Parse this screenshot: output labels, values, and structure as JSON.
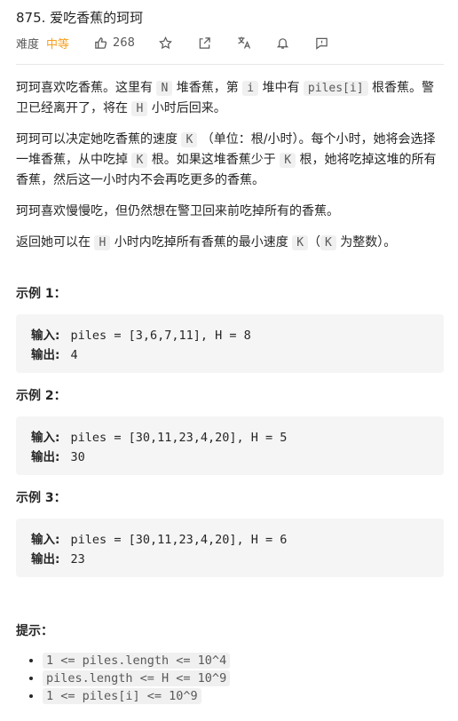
{
  "problem": {
    "number_title": "875. 爱吃香蕉的珂珂"
  },
  "meta": {
    "difficulty_label": "难度",
    "difficulty": "中等",
    "likes": "268",
    "difficulty_color": "#f7a01e"
  },
  "description": {
    "p1_a": "珂珂喜欢吃香蕉。这里有 ",
    "p1_N": "N",
    "p1_b": " 堆香蕉，第 ",
    "p1_i": "i",
    "p1_c": " 堆中有 ",
    "p1_piles": "piles[i]",
    "p1_d": " 根香蕉。警卫已经离开了，将在 ",
    "p1_H": "H",
    "p1_e": " 小时后回来。",
    "p2_a": "珂珂可以决定她吃香蕉的速度 ",
    "p2_K1": "K",
    "p2_b": " （单位：根/小时）。每个小时，她将会选择一堆香蕉，从中吃掉 ",
    "p2_K2": "K",
    "p2_c": " 根。如果这堆香蕉少于 ",
    "p2_K3": "K",
    "p2_d": " 根，她将吃掉这堆的所有香蕉，然后这一小时内不会再吃更多的香蕉。",
    "p3": "珂珂喜欢慢慢吃，但仍然想在警卫回来前吃掉所有的香蕉。",
    "p4_a": "返回她可以在 ",
    "p4_H": "H",
    "p4_b": " 小时内吃掉所有香蕉的最小速度 ",
    "p4_K1": "K",
    "p4_c": "（",
    "p4_K2": "K",
    "p4_d": " 为整数）。"
  },
  "examples": [
    {
      "heading": "示例 1：",
      "input_label": "输入:",
      "input": "piles = [3,6,7,11], H = 8",
      "output_label": "输出:",
      "output": "4"
    },
    {
      "heading": "示例 2：",
      "input_label": "输入:",
      "input": "piles = [30,11,23,4,20], H = 5",
      "output_label": "输出:",
      "output": "30"
    },
    {
      "heading": "示例 3：",
      "input_label": "输入:",
      "input": "piles = [30,11,23,4,20], H = 6",
      "output_label": "输出:",
      "output": "23"
    }
  ],
  "hints": {
    "heading": "提示：",
    "items": [
      "1 <= piles.length <= 10^4",
      "piles.length <= H <= 10^9",
      "1 <= piles[i] <= 10^9"
    ]
  },
  "icons": [
    "thumbs-up-icon",
    "star-icon",
    "share-icon",
    "translate-icon",
    "bell-icon",
    "feedback-icon"
  ]
}
